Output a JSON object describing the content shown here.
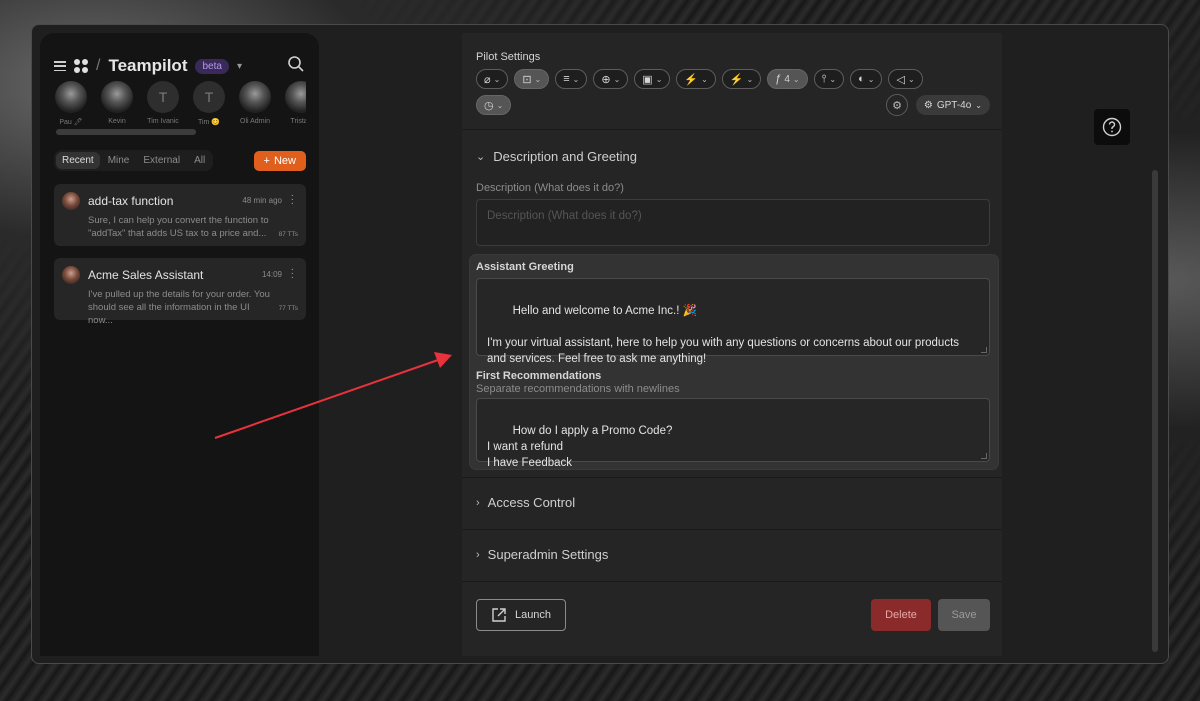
{
  "sidebar": {
    "app_name": "Teampilot",
    "badge": "beta",
    "avatars": [
      {
        "initial": "",
        "name": "Pau 🖊",
        "photo": true
      },
      {
        "initial": "",
        "name": "Kevin",
        "photo": true
      },
      {
        "initial": "T",
        "name": "Tim Ivanic",
        "photo": false
      },
      {
        "initial": "T",
        "name": "Tim 😊",
        "photo": false
      },
      {
        "initial": "",
        "name": "Oli Admin",
        "photo": true
      },
      {
        "initial": "",
        "name": "Tristan",
        "photo": true
      }
    ],
    "filters": [
      "Recent",
      "Mine",
      "External",
      "All"
    ],
    "new_button": "New",
    "chats": [
      {
        "title": "add-tax function",
        "time": "48 min ago",
        "preview": "Sure, I can help you convert the function to \"addTax\" that adds US tax to a price and...",
        "tokens": "87 TTs"
      },
      {
        "title": "Acme Sales Assistant",
        "time": "14:09",
        "preview": "I've pulled up the details for your order. You should see all the information in the UI now...",
        "tokens": "77 TTs"
      }
    ]
  },
  "panel": {
    "pilot_settings_title": "Pilot Settings",
    "toolbar_count": "4",
    "model": "GPT-4o",
    "sections": {
      "description_greeting": "Description and Greeting",
      "access_control": "Access Control",
      "superadmin": "Superadmin Settings"
    },
    "description_label": "Description (What does it do?)",
    "description_placeholder": "Description (What does it do?)",
    "greeting_label": "Assistant Greeting",
    "greeting_value": "Hello and welcome to Acme Inc.! 🎉\n\nI'm your virtual assistant, here to help you with any questions or concerns about our products and services. Feel free to ask me anything!",
    "recommendations_label": "First Recommendations",
    "recommendations_sub": "Separate recommendations with newlines",
    "recommendations_value": "How do I apply a Promo Code?\nI want a refund\nI have Feedback",
    "launch": "Launch",
    "delete": "Delete",
    "save": "Save"
  },
  "colors": {
    "accent_orange": "#e15f1d",
    "delete_red": "#8a2a2a",
    "beta_purple": "#b49be8",
    "annotation_arrow": "#e8323c"
  }
}
